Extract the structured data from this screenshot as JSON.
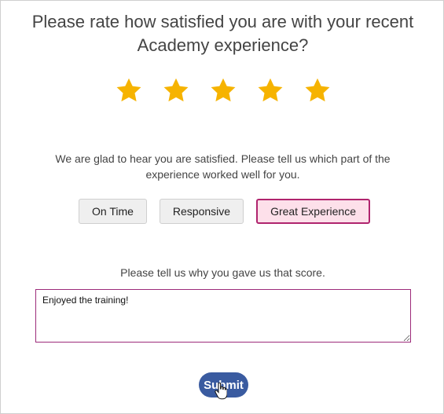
{
  "survey": {
    "question_line1": "Please rate how satisfied you are with your recent",
    "question_line2": "Academy experience?",
    "rating": {
      "value": 5,
      "max": 5,
      "star_color": "#f6b300",
      "icon": "star-icon"
    },
    "feedback_line1": "We are glad to hear you are satisfied. Please tell us which part of the",
    "feedback_line2": "experience worked well for you.",
    "options": [
      {
        "label": "On Time",
        "selected": false
      },
      {
        "label": "Responsive",
        "selected": false
      },
      {
        "label": "Great Experience",
        "selected": true
      }
    ],
    "comment_prompt": "Please tell us why you gave us that score.",
    "comment_value": "Enjoyed the training!",
    "submit_label": "Submit"
  },
  "colors": {
    "accent": "#3a5ba0",
    "selected_fill": "#fde0ea",
    "selected_border": "#b0246e"
  }
}
